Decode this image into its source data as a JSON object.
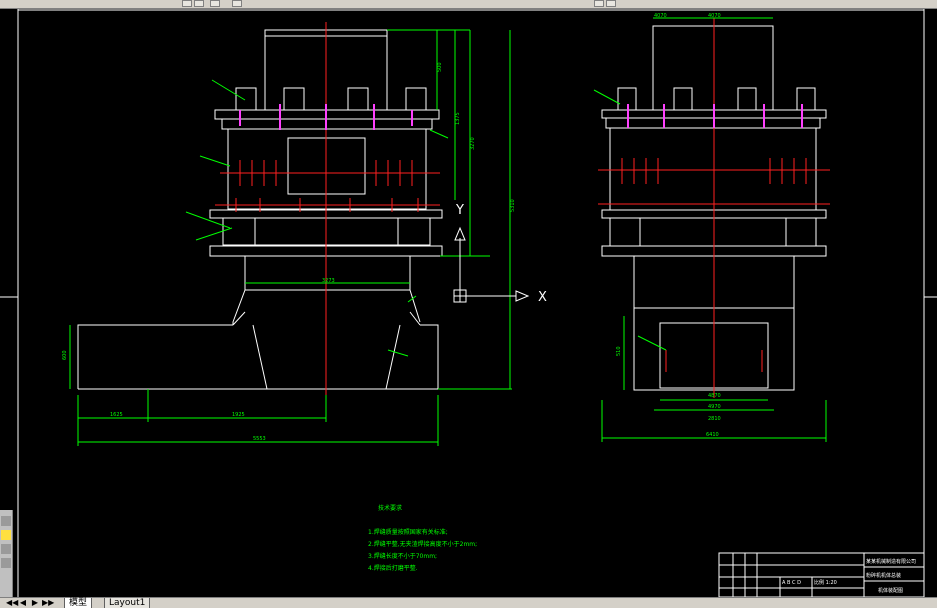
{
  "app": {
    "name": "CAD drawing viewer"
  },
  "tabs": [
    {
      "label": "模型"
    },
    {
      "label": "Layout1"
    }
  ],
  "tab_nav": [
    "◀◀",
    "◀",
    "▶",
    "▶▶"
  ],
  "ucs": {
    "x_label": "X",
    "y_label": "Y"
  },
  "dimensions": {
    "front_top_width": "4070",
    "side_top_width": "4070",
    "front_dim_a": "500",
    "front_dim_b": "1375",
    "front_dim_c": "3270",
    "front_dim_d": "5310",
    "front_bottom_a": "1625",
    "front_bottom_b": "1925",
    "front_bottom_total": "5553",
    "front_mid": "3273",
    "front_left_h": "600",
    "side_inner_a": "4870",
    "side_inner_b": "4970",
    "side_inner_c": "2810",
    "side_total": "6410",
    "side_left_h": "510"
  },
  "notes": {
    "title": "技术要求",
    "items": [
      "1.焊缝质量按照国家有关标准;",
      "2.焊缝平整,无夹渣焊接高度不小于2mm;",
      "3.焊缝长度不小于70mm;",
      "4.焊接后打磨平整."
    ]
  },
  "title_block": {
    "r1": "某某机械制造有限公司",
    "r2": "粉碎机机体总装",
    "r3": "比例 1:20",
    "r4": "机体装配图",
    "scale_cells": "A  B  C  D"
  }
}
